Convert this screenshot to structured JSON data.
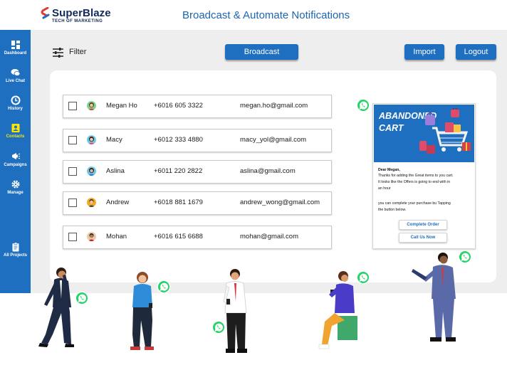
{
  "brand": {
    "name": "SuperBlaze",
    "tagline": "TECH OF MARKETING"
  },
  "header": {
    "title": "Broadcast & Automate Notifications"
  },
  "sidebar": {
    "items": [
      {
        "label": "Dashboard",
        "icon": "dashboard-icon"
      },
      {
        "label": "Live Chat",
        "icon": "chat-icon"
      },
      {
        "label": "History",
        "icon": "history-icon"
      },
      {
        "label": "Contacts",
        "icon": "contacts-icon",
        "active": true
      },
      {
        "label": "Campaigns",
        "icon": "megaphone-icon"
      },
      {
        "label": "Manage",
        "icon": "gear-icon"
      },
      {
        "label": "All Projects",
        "icon": "clipboard-icon"
      }
    ]
  },
  "toolbar": {
    "filter_label": "Filter",
    "broadcast_label": "Broadcast",
    "import_label": "Import",
    "logout_label": "Logout"
  },
  "contacts": [
    {
      "name": "Megan Ho",
      "phone": "+6016 605 3322",
      "email": "megan.ho@gmail.com"
    },
    {
      "name": "Macy",
      "phone": "+6012 333 4880",
      "email": "macy_yol@gmail.com"
    },
    {
      "name": "Aslina",
      "phone": "+6011 220 2822",
      "email": "aslina@gmail.com"
    },
    {
      "name": "Andrew",
      "phone": "+6018 881 1679",
      "email": "andrew_wong@gmail.com"
    },
    {
      "name": "Mohan",
      "phone": "+6016 615 6688",
      "email": "mohan@gmail.com"
    }
  ],
  "message": {
    "banner_title": "ABANDONED CART",
    "lines": [
      "Dear Megan,",
      "Thanks for adding the Great items to you cart.",
      "It looks like the Offers is going to end with in",
      "an hour",
      "",
      "you can complete your purchase bu Tapping",
      "the button below."
    ],
    "buttons": [
      "Complete Order",
      "Call Us Now"
    ]
  },
  "colors": {
    "primary": "#1e6fbf",
    "active": "#ffe600",
    "whatsapp": "#25d366"
  }
}
